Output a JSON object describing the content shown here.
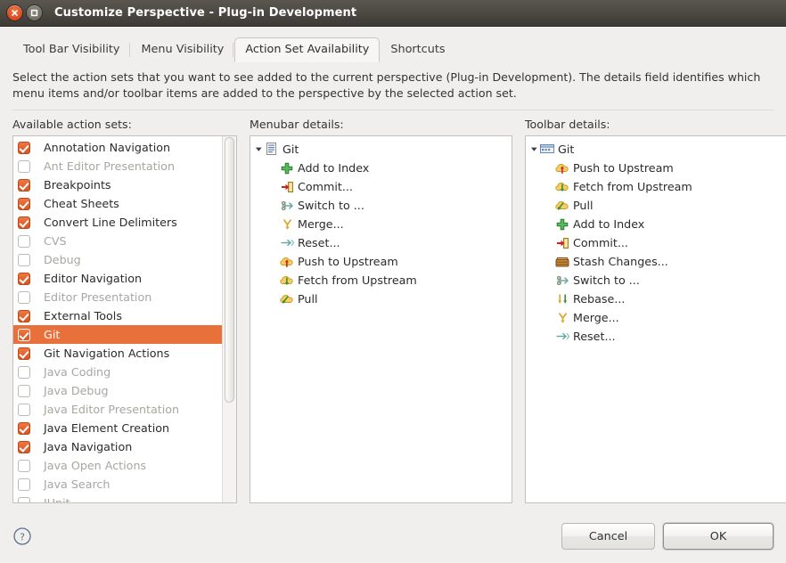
{
  "window": {
    "title": "Customize Perspective - Plug-in Development",
    "close_icon": "close-icon",
    "maximize_icon": "maximize-icon"
  },
  "tabs": [
    {
      "label": "Tool Bar Visibility",
      "active": false
    },
    {
      "label": "Menu Visibility",
      "active": false
    },
    {
      "label": "Action Set Availability",
      "active": true
    },
    {
      "label": "Shortcuts",
      "active": false
    }
  ],
  "description": "Select the action sets that you want to see added to the current perspective (Plug-in Development).  The details field identifies which menu items and/or toolbar items are added to the perspective by the selected action set.",
  "columns": {
    "available_label": "Available action sets:",
    "menubar_label": "Menubar details:",
    "toolbar_label": "Toolbar details:"
  },
  "action_sets": [
    {
      "label": "Annotation Navigation",
      "checked": true,
      "enabled": true,
      "selected": false
    },
    {
      "label": "Ant Editor Presentation",
      "checked": false,
      "enabled": false,
      "selected": false
    },
    {
      "label": "Breakpoints",
      "checked": true,
      "enabled": true,
      "selected": false
    },
    {
      "label": "Cheat Sheets",
      "checked": true,
      "enabled": true,
      "selected": false
    },
    {
      "label": "Convert Line Delimiters",
      "checked": true,
      "enabled": true,
      "selected": false
    },
    {
      "label": "CVS",
      "checked": false,
      "enabled": false,
      "selected": false
    },
    {
      "label": "Debug",
      "checked": false,
      "enabled": false,
      "selected": false
    },
    {
      "label": "Editor Navigation",
      "checked": true,
      "enabled": true,
      "selected": false
    },
    {
      "label": "Editor Presentation",
      "checked": false,
      "enabled": false,
      "selected": false
    },
    {
      "label": "External Tools",
      "checked": true,
      "enabled": true,
      "selected": false
    },
    {
      "label": "Git",
      "checked": true,
      "enabled": true,
      "selected": true
    },
    {
      "label": "Git Navigation Actions",
      "checked": true,
      "enabled": true,
      "selected": false
    },
    {
      "label": "Java Coding",
      "checked": false,
      "enabled": false,
      "selected": false
    },
    {
      "label": "Java Debug",
      "checked": false,
      "enabled": false,
      "selected": false
    },
    {
      "label": "Java Editor Presentation",
      "checked": false,
      "enabled": false,
      "selected": false
    },
    {
      "label": "Java Element Creation",
      "checked": true,
      "enabled": true,
      "selected": false
    },
    {
      "label": "Java Navigation",
      "checked": true,
      "enabled": true,
      "selected": false
    },
    {
      "label": "Java Open Actions",
      "checked": false,
      "enabled": false,
      "selected": false
    },
    {
      "label": "Java Search",
      "checked": false,
      "enabled": false,
      "selected": false
    },
    {
      "label": "JUnit",
      "checked": false,
      "enabled": false,
      "selected": false
    }
  ],
  "menubar_details": {
    "root": {
      "label": "Git",
      "icon": "menu-icon",
      "expanded": true
    },
    "items": [
      {
        "label": "Add to Index",
        "icon": "add-icon"
      },
      {
        "label": "Commit...",
        "icon": "commit-icon"
      },
      {
        "label": "Switch to ...",
        "icon": "switch-icon"
      },
      {
        "label": "Merge...",
        "icon": "merge-icon"
      },
      {
        "label": "Reset...",
        "icon": "reset-icon"
      },
      {
        "label": "Push to Upstream",
        "icon": "push-icon"
      },
      {
        "label": "Fetch from Upstream",
        "icon": "fetch-icon"
      },
      {
        "label": "Pull",
        "icon": "pull-icon"
      }
    ]
  },
  "toolbar_details": {
    "root": {
      "label": "Git",
      "icon": "toolbar-icon",
      "expanded": true
    },
    "items": [
      {
        "label": "Push to Upstream",
        "icon": "push-icon"
      },
      {
        "label": "Fetch from Upstream",
        "icon": "fetch-icon"
      },
      {
        "label": "Pull",
        "icon": "pull-icon"
      },
      {
        "label": "Add to Index",
        "icon": "add-icon"
      },
      {
        "label": "Commit...",
        "icon": "commit-icon"
      },
      {
        "label": "Stash Changes...",
        "icon": "stash-icon"
      },
      {
        "label": "Switch to ...",
        "icon": "switch-icon"
      },
      {
        "label": "Rebase...",
        "icon": "rebase-icon"
      },
      {
        "label": "Merge...",
        "icon": "merge-icon"
      },
      {
        "label": "Reset...",
        "icon": "reset-icon"
      }
    ]
  },
  "footer": {
    "help_icon": "help-icon",
    "cancel_label": "Cancel",
    "ok_label": "OK"
  },
  "colors": {
    "selection": "#e8703b",
    "checkbox_on": "#d7551f",
    "titlebar": "#4b4842",
    "dialog_bg": "#f0efee",
    "panel_bg": "#ffffff"
  }
}
